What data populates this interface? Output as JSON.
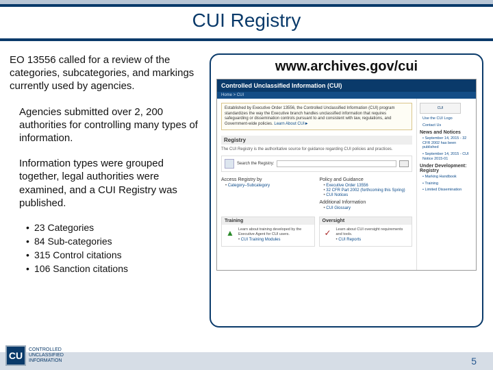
{
  "title": "CUI Registry",
  "page_number": "5",
  "left": {
    "p1": "EO 13556 called for a review of the categories, subcategories, and markings currently used by agencies.",
    "p2": "Agencies submitted over 2, 200 authorities for controlling many types of information.",
    "p3": "Information types were grouped together, legal authorities were examined, and a CUI Registry was published.",
    "bullets": [
      "23 Categories",
      "84 Sub-categories",
      "315 Control citations",
      "106 Sanction citations"
    ]
  },
  "right": {
    "url": "www.archives.gov/cui",
    "banner": "Controlled Unclassified Information (CUI)",
    "breadcrumb": "Home > CUI",
    "intro": "Established by Executive Order 13556, the Controlled Unclassified Information (CUI) program standardizes the way the Executive branch handles unclassified information that requires safeguarding or dissemination controls pursuant to and consistent with law, regulations, and Government-wide policies. ",
    "intro_link": "Learn About CUI►",
    "registry_h": "Registry",
    "registry_desc": "The CUI Registry is the authoritative source for guidance regarding CUI policies and practices.",
    "search_label": "Search the Registry:",
    "col1_h": "Access Registry by",
    "col1_links": [
      "Category–Subcategory"
    ],
    "col2_h": "Policy and Guidance",
    "col2_links": [
      "Executive Order 13556",
      "32 CFR Part 2002 (forthcoming this Spring)",
      "CUI Notices"
    ],
    "col2_h2": "Additional Information",
    "col2_links2": [
      "CUI Glossary"
    ],
    "training_h": "Training",
    "training_text": "Learn about training developed by the Executive Agent for CUI users.",
    "training_link": "CUI Training Modules",
    "oversight_h": "Oversight",
    "oversight_text": "Learn about CUI oversight requirements and tools.",
    "oversight_link": "CUI Reports",
    "side_logo": "CUI",
    "side_links_top": [
      "Use the CUI Logo",
      "Contact Us"
    ],
    "side_h1": "News and Notices",
    "side_news": [
      {
        "t": "September 14, 2015 - 32 CFR 2002 has been published",
        "d": ""
      },
      {
        "t": "September 14, 2015 - CUI Notice 2015-01",
        "d": ""
      }
    ],
    "side_h2": "Under Development: Registry",
    "side_dev": [
      "Marking Handbook",
      "Training",
      "Limited Dissemination"
    ]
  },
  "footer_logo": {
    "abbr": "CU",
    "t1": "CONTROLLED",
    "t2": "UNCLASSIFIED",
    "t3": "INFORMATION"
  }
}
